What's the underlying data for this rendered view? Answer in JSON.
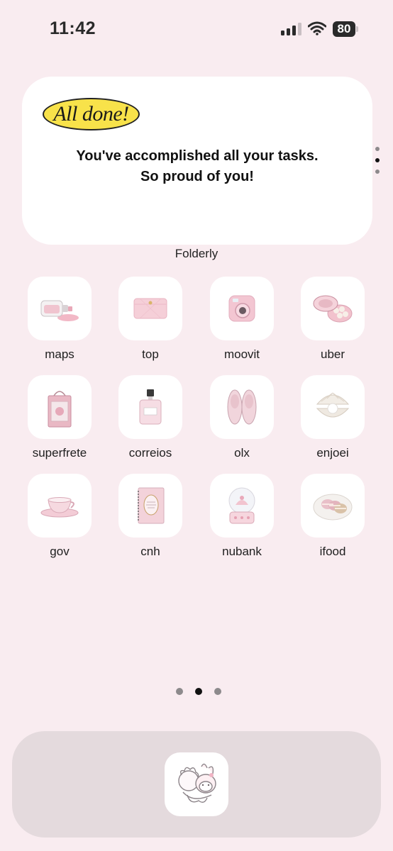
{
  "status_bar": {
    "time": "11:42",
    "battery": "80"
  },
  "widget": {
    "badge": "All done!",
    "message_line1": "You've accomplished all your tasks.",
    "message_line2": "So proud of you!",
    "label": "Folderly"
  },
  "apps": [
    {
      "label": "maps",
      "icon": "perfume-bottle-tipped-icon"
    },
    {
      "label": "top",
      "icon": "pink-wallet-icon"
    },
    {
      "label": "moovit",
      "icon": "instant-camera-icon"
    },
    {
      "label": "uber",
      "icon": "macaron-box-icon"
    },
    {
      "label": "superfrete",
      "icon": "gift-bag-icon"
    },
    {
      "label": "correios",
      "icon": "perfume-icon"
    },
    {
      "label": "olx",
      "icon": "ballet-flats-icon"
    },
    {
      "label": "enjoei",
      "icon": "pearl-shell-icon"
    },
    {
      "label": "gov",
      "icon": "teacup-icon"
    },
    {
      "label": "cnh",
      "icon": "notebook-icon"
    },
    {
      "label": "nubank",
      "icon": "snow-globe-icon"
    },
    {
      "label": "ifood",
      "icon": "macarons-plate-icon"
    }
  ],
  "dock": {
    "apps": [
      {
        "icon": "my-melody-sticker-icon"
      }
    ]
  },
  "page_indicator": {
    "pages": 3,
    "current": 2
  },
  "colors": {
    "background": "#f9ecf0",
    "widget": "#ffffff",
    "badge": "#f8e24a",
    "dock": "#e4dadd"
  }
}
